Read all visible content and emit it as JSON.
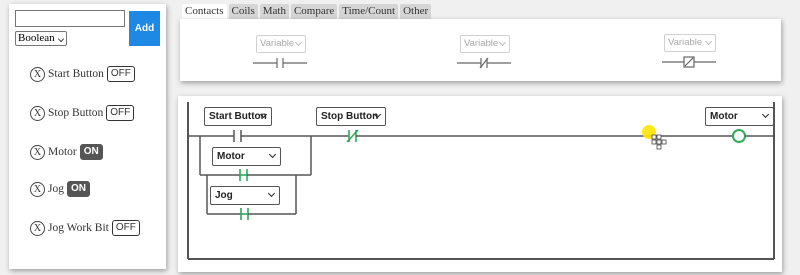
{
  "sidebar": {
    "name_input_value": "",
    "type_select_value": "Boolean",
    "add_label": "Add",
    "delete_glyph": "X",
    "variables": [
      {
        "name": "Start Button",
        "state": "OFF"
      },
      {
        "name": "Stop Button",
        "state": "OFF"
      },
      {
        "name": "Motor",
        "state": "ON"
      },
      {
        "name": "Jog",
        "state": "ON"
      },
      {
        "name": "Jog Work Bit",
        "state": "OFF"
      }
    ]
  },
  "tabs": [
    {
      "label": "Contacts",
      "active": true
    },
    {
      "label": "Coils",
      "active": false
    },
    {
      "label": "Math",
      "active": false
    },
    {
      "label": "Compare",
      "active": false
    },
    {
      "label": "Time/Count",
      "active": false
    },
    {
      "label": "Other",
      "active": false
    }
  ],
  "palette": {
    "items": [
      {
        "placeholder": "Variable",
        "symbol": "normally-open-contact-icon"
      },
      {
        "placeholder": "Variable",
        "symbol": "normally-closed-contact-icon"
      },
      {
        "placeholder": "Variable",
        "symbol": "nc-boxed-contact-icon"
      }
    ]
  },
  "rung": {
    "contact_start": "Start Button",
    "contact_stop": "Stop Button",
    "branch_motor": "Motor",
    "branch_jog": "Jog",
    "coil_motor": "Motor"
  },
  "colors": {
    "accent_blue": "#1e88e5",
    "energized_green": "#2eaa5b",
    "rail_gray": "#555555",
    "cursor_yellow": "#ffe600"
  }
}
